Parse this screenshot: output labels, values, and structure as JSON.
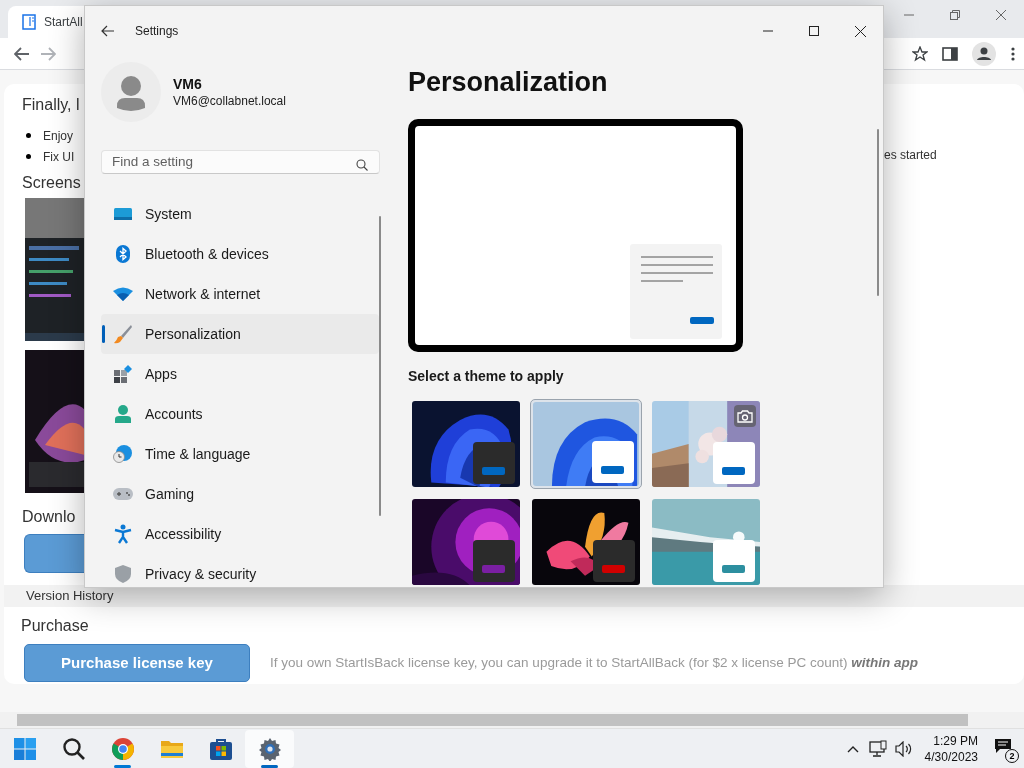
{
  "browser": {
    "tab_title": "StartAll",
    "page": {
      "heading": "Finally, l",
      "bullets": [
        "Enjoy",
        "Fix UI"
      ],
      "right_text": "es started",
      "screenshots_heading": "Screens",
      "download_heading": "Downlo",
      "version_history": "Version History",
      "purchase_heading": "Purchase",
      "purchase_button": "Purchase license key",
      "purchase_note": "If you own StartIsBack license key, you can upgrade it to StartAllBack (for $2 x license PC count) **within app**"
    }
  },
  "settings": {
    "window": {
      "title": "Settings"
    },
    "account": {
      "name": "VM6",
      "email": "VM6@collabnet.local"
    },
    "search": {
      "placeholder": "Find a setting"
    },
    "nav": [
      {
        "label": "System",
        "selected": false
      },
      {
        "label": "Bluetooth & devices",
        "selected": false
      },
      {
        "label": "Network & internet",
        "selected": false
      },
      {
        "label": "Personalization",
        "selected": true
      },
      {
        "label": "Apps",
        "selected": false
      },
      {
        "label": "Accounts",
        "selected": false
      },
      {
        "label": "Time & language",
        "selected": false
      },
      {
        "label": "Gaming",
        "selected": false
      },
      {
        "label": "Accessibility",
        "selected": false
      },
      {
        "label": "Privacy & security",
        "selected": false
      }
    ],
    "page_title": "Personalization",
    "themes_label": "Select a theme to apply",
    "themes": [
      {
        "selected": false,
        "kind": "dark",
        "color": "#0067c0"
      },
      {
        "selected": true,
        "kind": "light",
        "color": "#0067c0"
      },
      {
        "selected": false,
        "kind": "light",
        "color": "#0067c0"
      },
      {
        "selected": false,
        "kind": "dark",
        "color": "#7a1fa2"
      },
      {
        "selected": false,
        "kind": "dark",
        "color": "#d10000"
      },
      {
        "selected": false,
        "kind": "light",
        "color": "#2d8fa0"
      }
    ]
  },
  "taskbar": {
    "apps": [
      {
        "selected": false,
        "running": false
      },
      {
        "selected": false,
        "running": false
      },
      {
        "selected": false,
        "running": true
      },
      {
        "selected": false,
        "running": false
      },
      {
        "selected": false,
        "running": false
      },
      {
        "selected": true,
        "running": true
      }
    ],
    "time": "1:29 PM",
    "date": "4/30/2023",
    "notifications": "2"
  }
}
